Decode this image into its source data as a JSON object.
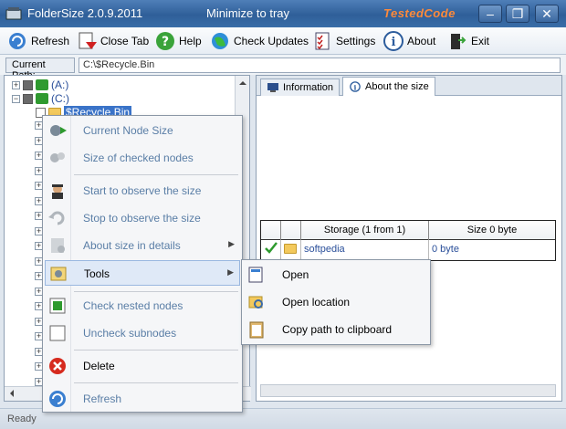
{
  "window": {
    "title": "FolderSize 2.0.9.2011",
    "tray_label": "Minimize to tray",
    "brand": "TestedCode",
    "minimize": "–",
    "maximize": "❐",
    "close": "✕"
  },
  "toolbar": {
    "refresh": "Refresh",
    "close_tab": "Close Tab",
    "help": "Help",
    "check_updates": "Check Updates",
    "settings": "Settings",
    "about": "About",
    "exit": "Exit"
  },
  "path": {
    "label": "Current Path:",
    "value": "C:\\$Recycle.Bin"
  },
  "tree": {
    "items": [
      {
        "label": "(A:)",
        "expander": "+"
      },
      {
        "label": "(C:)",
        "expander": "−"
      },
      {
        "label": "$Recycle.Bin"
      }
    ]
  },
  "tabs": {
    "information": "Information",
    "about_size": "About the size"
  },
  "grid": {
    "headers": [
      "Storage (1 from 1)",
      "Size 0 byte"
    ],
    "rows": [
      {
        "name": "softpedia",
        "size": "0 byte"
      }
    ]
  },
  "status": "Ready",
  "context_menu": {
    "items": [
      {
        "label": "Current Node Size",
        "icon": "gears-icon"
      },
      {
        "label": "Size of checked nodes",
        "icon": "gears-gray-icon"
      },
      {
        "label": "Start to observe the size",
        "icon": "spy-icon"
      },
      {
        "label": "Stop to observe the size",
        "icon": "undo-icon"
      },
      {
        "label": "About size in details",
        "icon": "details-icon"
      },
      {
        "label": "Tools",
        "icon": "tools-icon"
      },
      {
        "label": "Check nested nodes",
        "icon": "check-nested-icon"
      },
      {
        "label": "Uncheck subnodes",
        "icon": "uncheck-icon"
      },
      {
        "label": "Delete",
        "icon": "delete-icon"
      },
      {
        "label": "Refresh",
        "icon": "refresh-icon"
      }
    ]
  },
  "submenu": {
    "items": [
      {
        "label": "Open",
        "icon": "open-icon"
      },
      {
        "label": "Open location",
        "icon": "open-location-icon"
      },
      {
        "label": "Copy path to clipboard",
        "icon": "clipboard-icon"
      }
    ]
  },
  "colors": {
    "title_bar": "#3a6ea8",
    "selection": "#3a73c8",
    "link_text": "#2a4f9a",
    "brand": "#ff8a3a"
  }
}
